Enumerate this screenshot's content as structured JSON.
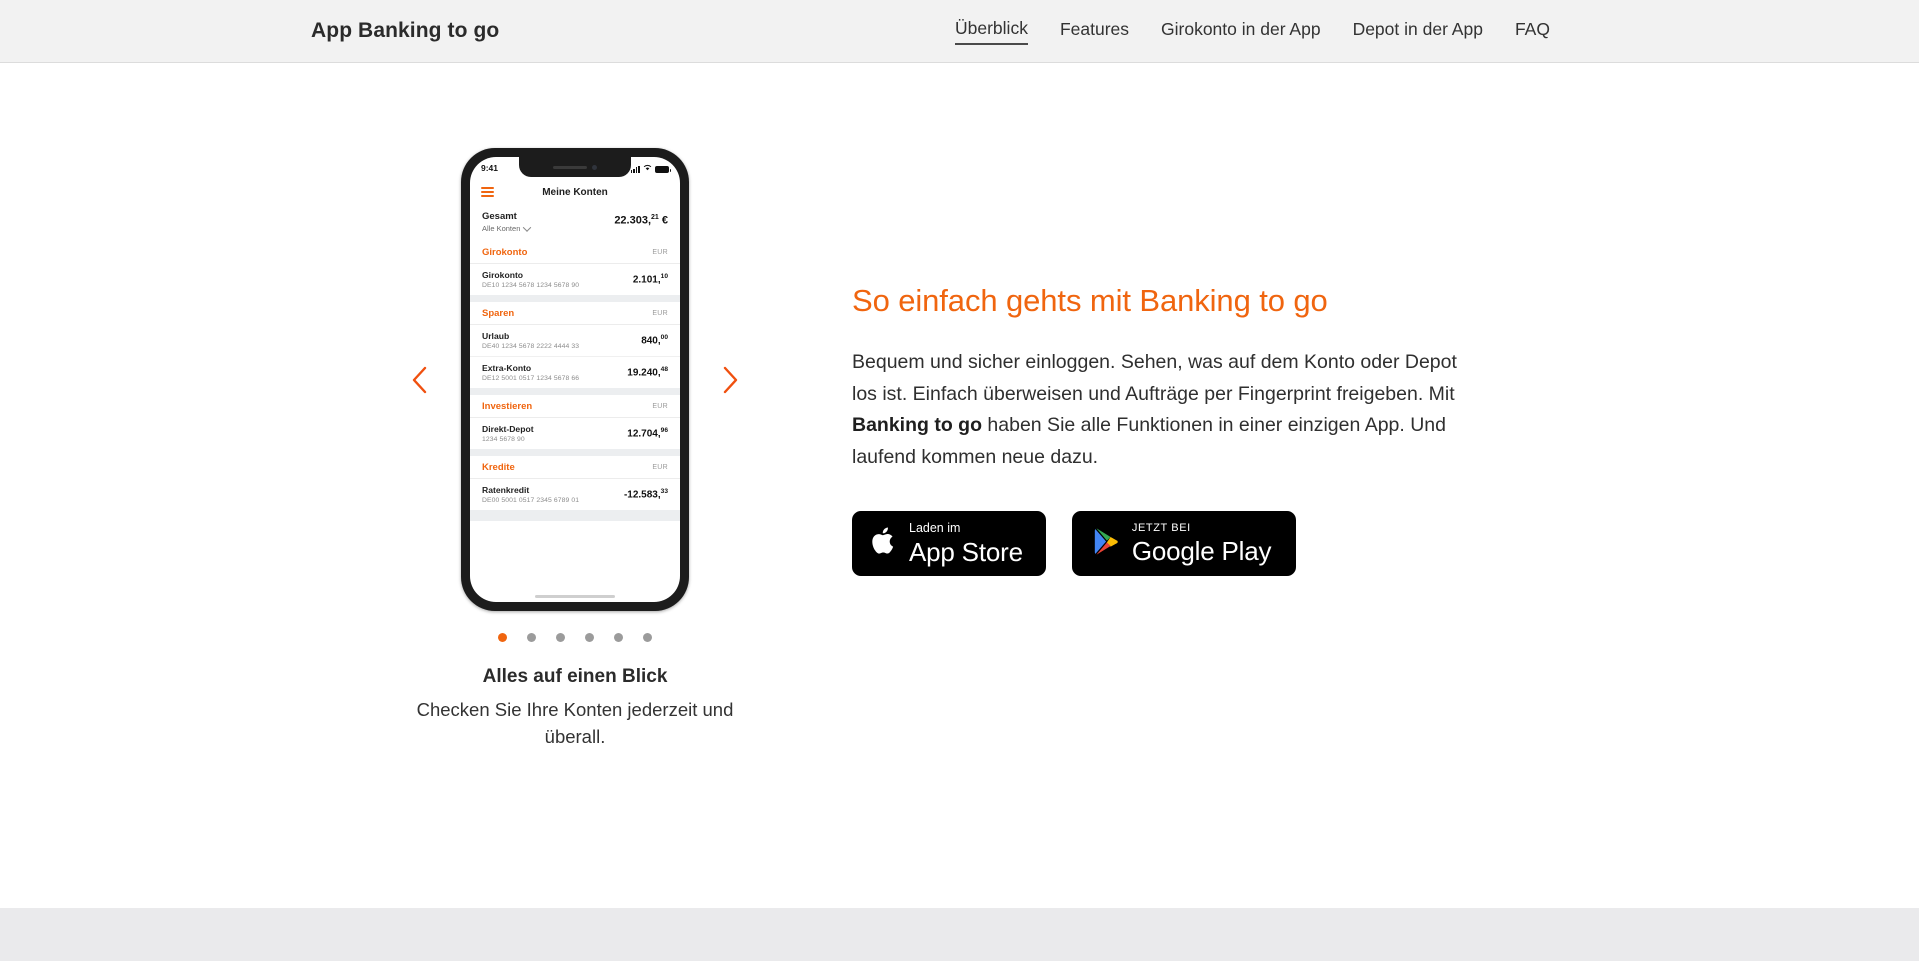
{
  "header": {
    "brand": "App Banking to go",
    "nav": [
      {
        "label": "Überblick",
        "active": true
      },
      {
        "label": "Features",
        "active": false
      },
      {
        "label": "Girokonto in der App",
        "active": false
      },
      {
        "label": "Depot in der App",
        "active": false
      },
      {
        "label": "FAQ",
        "active": false
      }
    ]
  },
  "carousel": {
    "prev_icon": "chevron-left-icon",
    "next_icon": "chevron-right-icon",
    "dots_total": 6,
    "active_dot": 1,
    "caption_title": "Alles auf einen Blick",
    "caption_subtitle": "Checken Sie Ihre Konten jederzeit und überall.",
    "phone": {
      "status": {
        "time": "9:41",
        "signal_icon": "signal-bars-icon",
        "wifi_icon": "wifi-icon",
        "battery_icon": "battery-full-icon"
      },
      "menu_icon": "hamburger-menu-icon",
      "app_title": "Meine Konten",
      "total": {
        "label": "Gesamt",
        "sub": "Alle Konten",
        "sub_icon": "chevron-down-icon",
        "amount_main": "22.303,",
        "amount_cents": "21",
        "currency": " €"
      },
      "groups": [
        {
          "name": "Girokonto",
          "currency": "EUR",
          "accounts": [
            {
              "name": "Girokonto",
              "iban": "DE10 1234 5678 1234 5678 90",
              "amount_main": "2.101,",
              "amount_cents": "10"
            }
          ]
        },
        {
          "name": "Sparen",
          "currency": "EUR",
          "accounts": [
            {
              "name": "Urlaub",
              "iban": "DE40 1234 5678 2222 4444 33",
              "amount_main": "840,",
              "amount_cents": "00"
            },
            {
              "name": "Extra-Konto",
              "iban": "DE12 5001 0517 1234 5678 66",
              "amount_main": "19.240,",
              "amount_cents": "48"
            }
          ]
        },
        {
          "name": "Investieren",
          "currency": "EUR",
          "accounts": [
            {
              "name": "Direkt-Depot",
              "iban": "1234 5678 90",
              "amount_main": "12.704,",
              "amount_cents": "96"
            }
          ]
        },
        {
          "name": "Kredite",
          "currency": "EUR",
          "accounts": [
            {
              "name": "Ratenkredit",
              "iban": "DE00 5001 0517 2345 6789 01",
              "amount_main": "-12.583,",
              "amount_cents": "33"
            }
          ]
        }
      ]
    }
  },
  "promo": {
    "title": "So einfach gehts mit Banking to go",
    "body_part1": "Bequem und sicher einloggen. Sehen, was auf dem Konto oder Depot los ist. Einfach überweisen und Aufträge per Fingerprint freigeben. Mit ",
    "body_bold": "Banking to go",
    "body_part2": " haben Sie alle Funktionen in einer einzigen App. Und laufend kommen neue dazu.",
    "badges": {
      "apple": {
        "icon": "apple-logo-icon",
        "small": "Laden im",
        "big": "App Store"
      },
      "google": {
        "icon": "google-play-logo-icon",
        "small": "JETZT BEI",
        "big": "Google Play"
      }
    }
  },
  "colors": {
    "accent_orange": "#f0650f",
    "header_bg": "#f2f2f2",
    "footer_bg": "#eaeaec",
    "text_dark": "#2b2b2b"
  }
}
